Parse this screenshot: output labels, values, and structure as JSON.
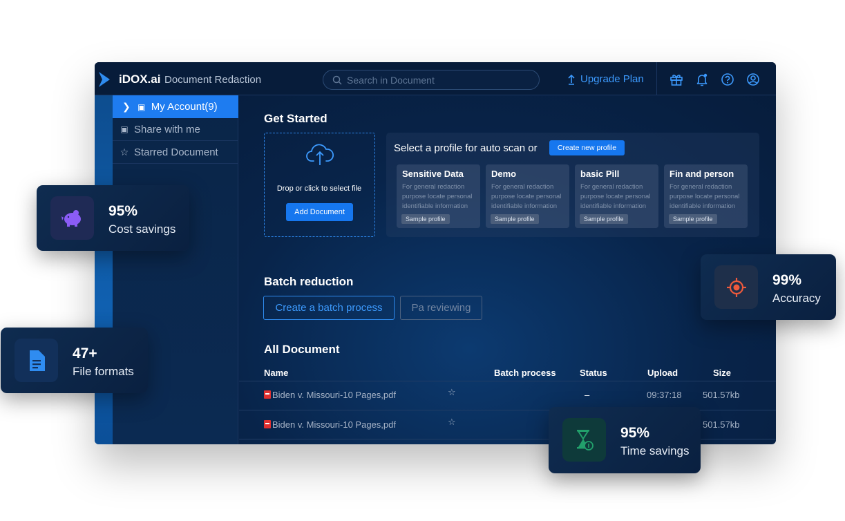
{
  "app": {
    "brand": "iDOX.ai",
    "title": "Document Redaction"
  },
  "search": {
    "placeholder": "Search in Document"
  },
  "topbar": {
    "upgrade_label": "Upgrade Plan",
    "icons": [
      "gift-icon",
      "bell-icon",
      "help-icon",
      "user-icon"
    ]
  },
  "sidebar": {
    "items": [
      {
        "label": "My Account(9)",
        "icon": "folder-icon",
        "active": true
      },
      {
        "label": "Share with me",
        "icon": "folder-icon"
      },
      {
        "label": "Starred Document",
        "icon": "star-icon"
      }
    ]
  },
  "get_started": {
    "title": "Get Started",
    "drop_text": "Drop or click to select file",
    "add_button": "Add Document",
    "profile_prompt": "Select a profile for auto scan or",
    "create_profile_button": "Create new profile",
    "profiles": [
      {
        "name": "Sensitive Data",
        "desc": "For general redaction purpose locate personal identifiable information",
        "tag": "Sample profile"
      },
      {
        "name": "Demo",
        "desc": "For general redaction purpose locate personal identifiable information",
        "tag": "Sample profile"
      },
      {
        "name": "basic Pill",
        "desc": "For general redaction purpose locate personal identifiable information",
        "tag": "Sample profile"
      },
      {
        "name": "Fin and person",
        "desc": "For general redaction purpose locate personal identifiable information",
        "tag": "Sample profile"
      }
    ]
  },
  "batch": {
    "title": "Batch reduction",
    "create_button": "Create a batch process",
    "reviewing_button": "Pa reviewing"
  },
  "documents": {
    "title": "All Document",
    "columns": [
      "Name",
      "Batch process",
      "Status",
      "Upload",
      "Size"
    ],
    "rows": [
      {
        "name": "Biden v. Missouri-10 Pages,pdf",
        "status": "–",
        "upload": "09:37:18",
        "size": "501.57kb"
      },
      {
        "name": "Biden v. Missouri-10 Pages,pdf",
        "status": "",
        "upload": "",
        "size": "501.57kb"
      }
    ]
  },
  "stats": [
    {
      "value": "95%",
      "label": "Cost savings",
      "icon": "piggy-bank-icon",
      "color": "#8b5cf6"
    },
    {
      "value": "47+",
      "label": "File formats",
      "icon": "document-icon",
      "color": "#2f8cf0"
    },
    {
      "value": "99%",
      "label": "Accuracy",
      "icon": "target-icon",
      "color": "#ef5a3c"
    },
    {
      "value": "95%",
      "label": "Time savings",
      "icon": "hourglass-icon",
      "color": "#22a06b"
    }
  ],
  "colors": {
    "accent": "#1677ef",
    "background": "#061a37",
    "sidebar_active": "#1e7cf0"
  }
}
